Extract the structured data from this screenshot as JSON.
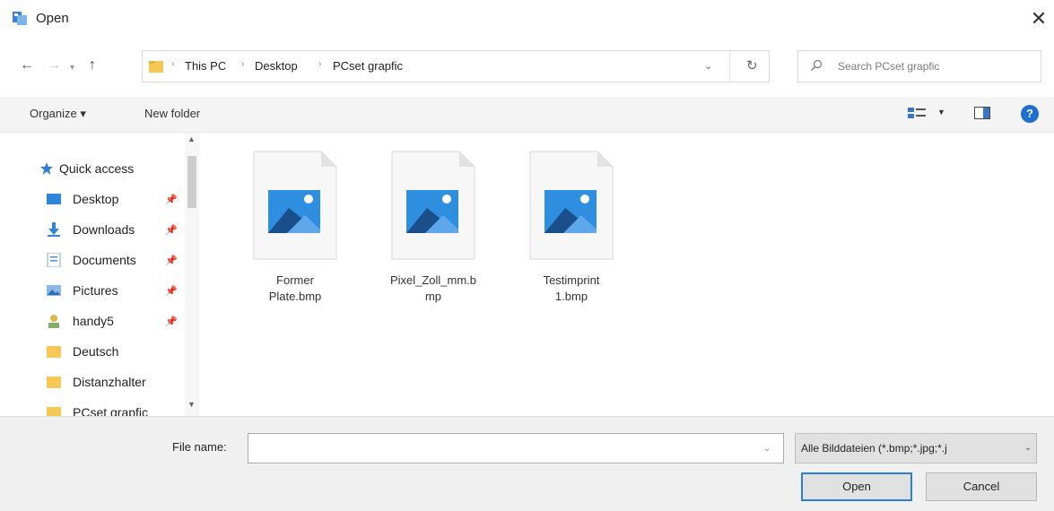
{
  "window": {
    "title": "Open"
  },
  "nav": {
    "breadcrumb": [
      "This PC",
      "Desktop",
      "PCset grapfic"
    ],
    "search_placeholder": "Search PCset grapfic"
  },
  "toolbar": {
    "organize": "Organize ▾",
    "new_folder": "New folder"
  },
  "sidebar": {
    "quick_access": "Quick access",
    "items": [
      {
        "label": "Desktop",
        "icon": "desktop-icon",
        "pinned": true
      },
      {
        "label": "Downloads",
        "icon": "download-icon",
        "pinned": true
      },
      {
        "label": "Documents",
        "icon": "document-icon",
        "pinned": true
      },
      {
        "label": "Pictures",
        "icon": "picture-icon",
        "pinned": true
      },
      {
        "label": "handy5",
        "icon": "user-folder-icon",
        "pinned": true
      },
      {
        "label": "Deutsch",
        "icon": "folder-icon",
        "pinned": false
      },
      {
        "label": "Distanzhalter",
        "icon": "folder-icon",
        "pinned": false
      },
      {
        "label": "PCset grapfic",
        "icon": "folder-icon",
        "pinned": false
      }
    ]
  },
  "files": [
    {
      "name_line1": "Former",
      "name_line2": "Plate.bmp",
      "icon": "image-file-icon"
    },
    {
      "name_line1": "Pixel_Zoll_mm.b",
      "name_line2": "mp",
      "icon": "image-file-icon"
    },
    {
      "name_line1": "Testimprint",
      "name_line2": "1.bmp",
      "icon": "image-file-icon"
    }
  ],
  "footer": {
    "file_name_label": "File name:",
    "file_name_value": "",
    "file_type": "Alle Bilddateien (*.bmp;*.jpg;*.j",
    "open_button": "Open",
    "cancel_button": "Cancel"
  },
  "colors": {
    "accent": "#2a7fd4",
    "folder": "#f6c957",
    "help": "#1f6fd1"
  }
}
